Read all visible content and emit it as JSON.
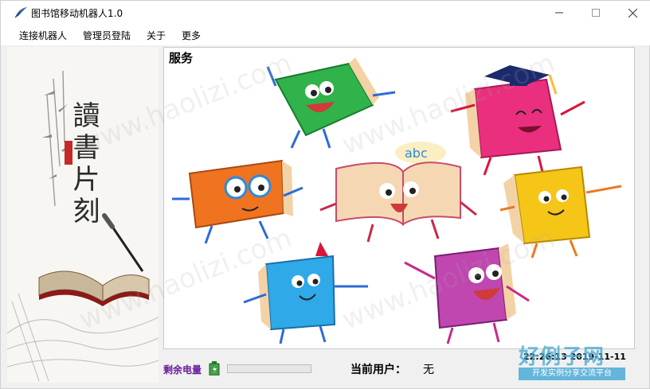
{
  "window": {
    "title": "图书馆移动机器人1.0"
  },
  "menu": {
    "items": [
      "连接机器人",
      "管理员登陆",
      "关于",
      "更多"
    ]
  },
  "left_panel": {
    "poster_text": "讀書片刻"
  },
  "main": {
    "service_label": "服务"
  },
  "status": {
    "battery_label": "剩余电量",
    "battery_level": 0,
    "user_label": "当前用户：",
    "user_value": "无",
    "clock_text": "22:26:13 2019-11-11"
  },
  "watermark": {
    "url": "www.haolizi.com",
    "brand": "好例子网",
    "slogan": "开发实例分享交流平台"
  },
  "colors": {
    "accent": "#6a1b9a",
    "battery_green": "#06b025",
    "watermark_blue": "#4aaad6"
  }
}
